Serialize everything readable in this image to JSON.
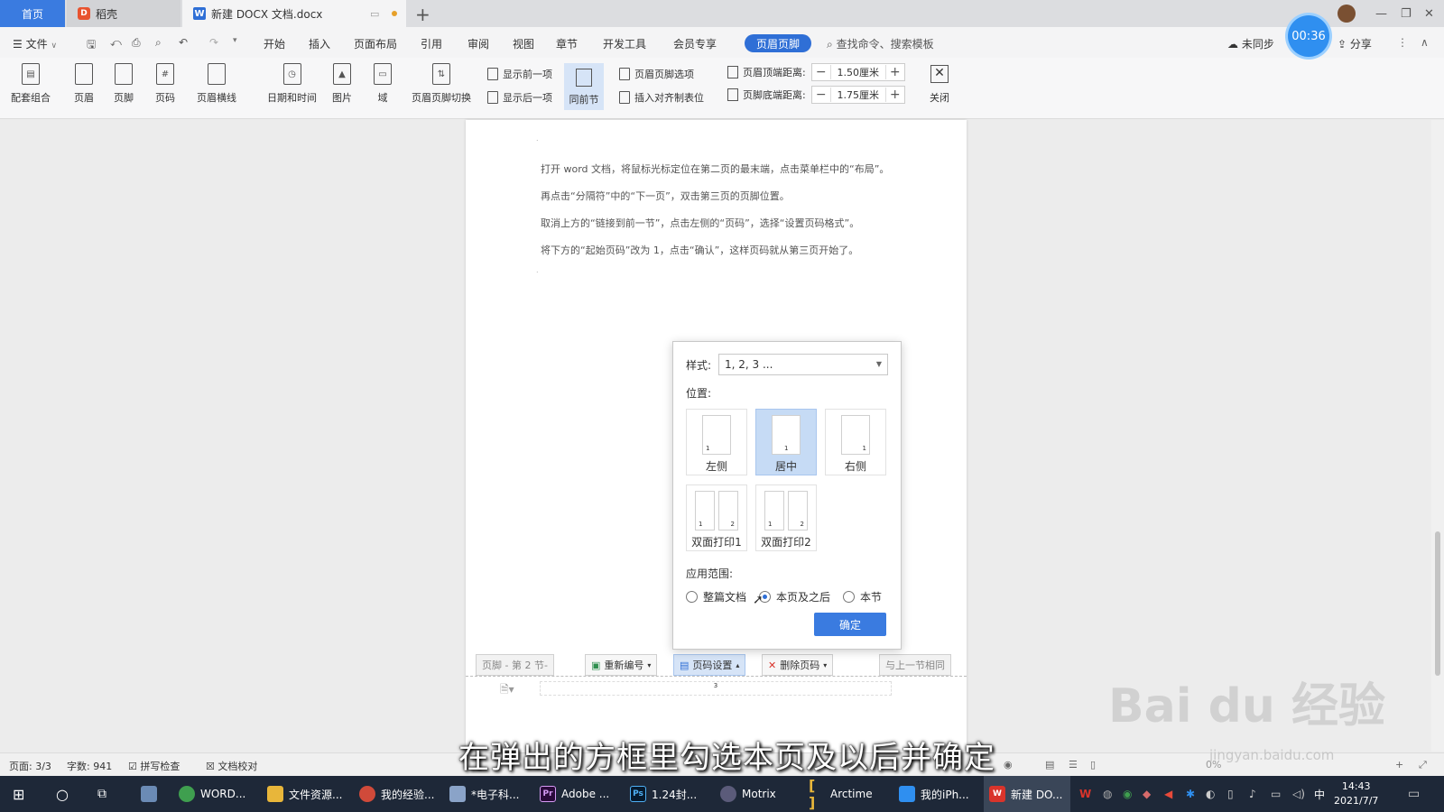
{
  "tabs": {
    "home": "首页",
    "daoke": "稻壳",
    "doc": "新建 DOCX 文档.docx",
    "new_tab": "+"
  },
  "timer": "00:36",
  "menu": {
    "file": "文件",
    "items": [
      "开始",
      "插入",
      "页面布局",
      "引用",
      "审阅",
      "视图",
      "章节",
      "开发工具",
      "会员专享"
    ],
    "active": "页眉页脚",
    "search": "查找命令、搜索模板",
    "sync": "未同步",
    "share": "分享"
  },
  "ribbon": {
    "combo": "配套组合",
    "header": "页眉",
    "footer": "页脚",
    "page_num": "页码",
    "header_line": "页眉横线",
    "datetime": "日期和时间",
    "picture": "图片",
    "field": "域",
    "switch": "页眉页脚切换",
    "show_prev": "显示前一项",
    "show_next": "显示后一项",
    "same_section": "同前节",
    "options": "页眉页脚选项",
    "insert_align": "插入对齐制表位",
    "header_top_label": "页眉顶端距离:",
    "header_top_value": "1.50厘米",
    "footer_bottom_label": "页脚底端距离:",
    "footer_bottom_value": "1.75厘米",
    "close": "关闭"
  },
  "document": {
    "paragraphs": [
      "打开 word 文档，将鼠标光标定位在第二页的最末端，点击菜单栏中的“布局”。",
      "再点击“分隔符”中的“下一页”，双击第三页的页脚位置。",
      "取消上方的“链接到前一节”，点击左侧的“页码”，选择“设置页码格式”。",
      "将下方的“起始页码”改为 1，点击“确认”，这样页码就从第三页开始了。"
    ]
  },
  "dialog": {
    "style_label": "样式:",
    "style_value": "1, 2, 3 ...",
    "position_label": "位置:",
    "positions": [
      "左侧",
      "居中",
      "右侧",
      "双面打印1",
      "双面打印2"
    ],
    "selected_position": "居中",
    "scope_label": "应用范围:",
    "scopes": [
      "整篇文档",
      "本页及之后",
      "本节"
    ],
    "selected_scope": "本页及之后",
    "ok": "确定"
  },
  "footer_bar": {
    "section": "页脚 - 第 2 节-",
    "renumber": "重新编号",
    "page_setup": "页码设置",
    "delete": "删除页码",
    "same_prev": "与上一节相同",
    "page_number": "3"
  },
  "status": {
    "page": "页面: 3/3",
    "words": "字数: 941",
    "spell": "拼写检查",
    "proof": "文档校对",
    "zoom": "0%"
  },
  "subtitle": "在弹出的方框里勾选本页及以后并确定",
  "watermark": "Bai du 经验",
  "watermark_url": "jingyan.baidu.com",
  "taskbar": {
    "items": [
      "WORD...",
      "文件资源...",
      "我的经验...",
      "*电子科...",
      "Adobe ...",
      "1.24封...",
      "Motrix",
      "Arctime",
      "我的iPh...",
      "新建 DO..."
    ],
    "time": "14:43",
    "date": "2021/7/7",
    "ime": "中"
  }
}
